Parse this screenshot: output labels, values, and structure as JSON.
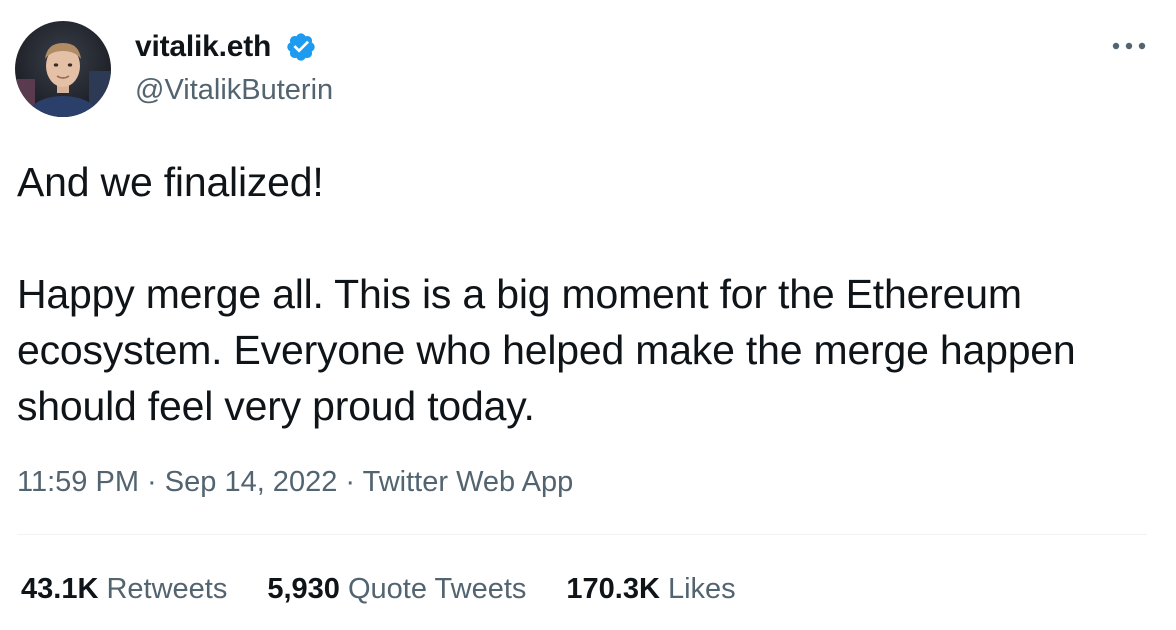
{
  "author": {
    "display_name": "vitalik.eth",
    "handle": "@VitalikButerin",
    "verified_icon": "verified-badge-icon",
    "verified_color": "#1d9bf0"
  },
  "menu": {
    "more_icon": "more-dots-icon"
  },
  "tweet": {
    "text": "And we finalized!\n\nHappy merge all. This is a big moment for the Ethereum ecosystem. Everyone who helped make the merge happen should feel very proud today."
  },
  "meta": {
    "time": "11:59 PM",
    "date": "Sep 14, 2022",
    "source": "Twitter Web App",
    "separator": "·"
  },
  "stats": {
    "retweets_count": "43.1K",
    "retweets_label": "Retweets",
    "quotes_count": "5,930",
    "quotes_label": "Quote Tweets",
    "likes_count": "170.3K",
    "likes_label": "Likes"
  },
  "colors": {
    "text": "#0f1419",
    "secondary_text": "#536471",
    "divider": "#eff3f4"
  }
}
